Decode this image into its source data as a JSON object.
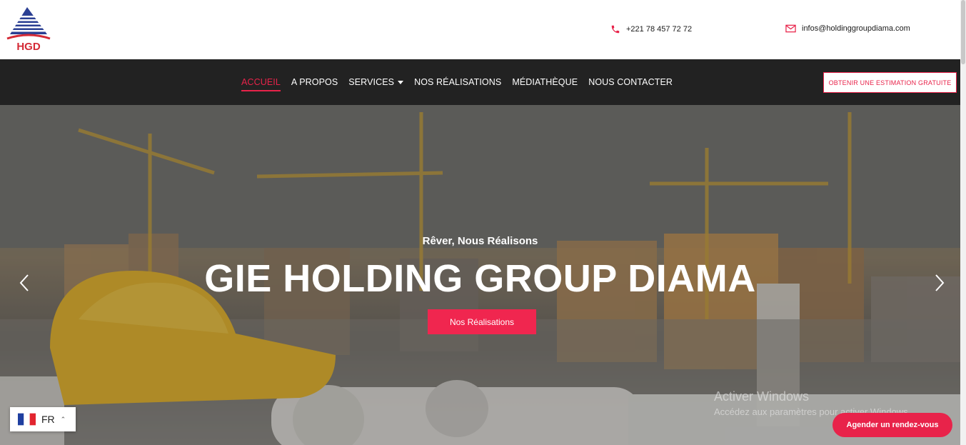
{
  "brand": {
    "logo_text": "HGD",
    "accent": "#e8234a",
    "logo_blue": "#2b3f93"
  },
  "header": {
    "phone": {
      "icon": "phone-icon",
      "text": "+221 78 457 72 72"
    },
    "email": {
      "icon": "mail-icon",
      "text": "infos@holdinggroupdiama.com"
    }
  },
  "nav": {
    "items": [
      {
        "label": "ACCUEIL",
        "active": true
      },
      {
        "label": "A PROPOS"
      },
      {
        "label": "SERVICES",
        "has_dropdown": true
      },
      {
        "label": "NOS RÉALISATIONS"
      },
      {
        "label": "MÉDIATHÈQUE"
      },
      {
        "label": "NOUS CONTACTER"
      }
    ],
    "cta_label": "OBTENIR UNE ESTIMATION GRATUITE"
  },
  "hero": {
    "tagline": "Rêver, Nous Réalisons",
    "headline": "GIE HOLDING GROUP DIAMA",
    "button_label": "Nos Réalisations",
    "prev_icon": "chevron-left-icon",
    "next_icon": "chevron-right-icon"
  },
  "watermark": {
    "line1": "Activer Windows",
    "line2": "Accédez aux paramètres pour activer Windows."
  },
  "language": {
    "code": "FR",
    "flag": "france-flag-icon"
  },
  "appointment_label": "Agender un rendez-vous"
}
